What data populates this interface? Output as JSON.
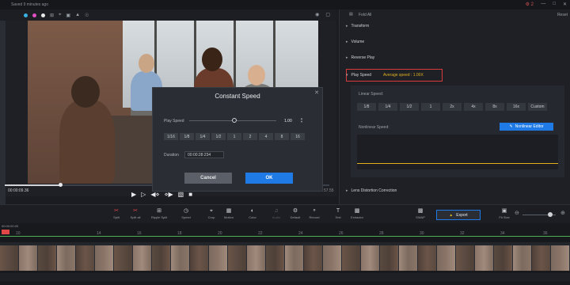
{
  "app": {
    "saved_status": "Saved 9 minutes ago",
    "notification_count": "2"
  },
  "preview": {
    "current_time": "00:00:09.36",
    "duration_partial": "57.55"
  },
  "dialog": {
    "title": "Constant Speed",
    "play_speed_label": "Play Speed",
    "play_speed_value": "1.00",
    "speed_options": [
      "1/16",
      "1/8",
      "1/4",
      "1/2",
      "1",
      "2",
      "4",
      "8",
      "16"
    ],
    "duration_label": "Duration",
    "duration_value": "00:00:28:234",
    "cancel_label": "Cancel",
    "ok_label": "OK"
  },
  "panel": {
    "fold_all": "Fold All",
    "reset": "Reset",
    "sections": {
      "transform": "Transform",
      "volume": "Volume",
      "reverse_play": "Reverse Play",
      "play_speed": "Play Speed",
      "lens": "Lens Distortion Correction"
    },
    "average_speed": "Average speed : 1.00X",
    "linear_speed_label": "Linear Speed:",
    "linear_options": [
      "1/8",
      "1/4",
      "1/2",
      "1",
      "2x",
      "4x",
      "8x",
      "16x",
      "Custom"
    ],
    "nonlinear_label": "Nonlinear Speed:",
    "nonlinear_button": "Nonlinear Editor",
    "accent": "#1f7ae6",
    "highlight": "#e0b020"
  },
  "toolbar": {
    "split": "Split",
    "split_all": "Split all",
    "ripple_split": "Ripple Split",
    "speed": "Speed",
    "crop": "Crop",
    "motion": "Motion",
    "color": "Color",
    "audio": "Audio",
    "default": "Default",
    "record": "Record",
    "text": "Text",
    "extractor": "Extractor",
    "swap": "SWAP",
    "export": "Export",
    "fit_size": "Fit Size"
  },
  "timeline": {
    "ruler_start": "00:00:00.00",
    "playhead_time": "00:00:09.36",
    "ticks": [
      "10",
      "14",
      "16",
      "18",
      "20",
      "22",
      "24",
      "26",
      "28",
      "30",
      "32",
      "34",
      "36"
    ]
  }
}
